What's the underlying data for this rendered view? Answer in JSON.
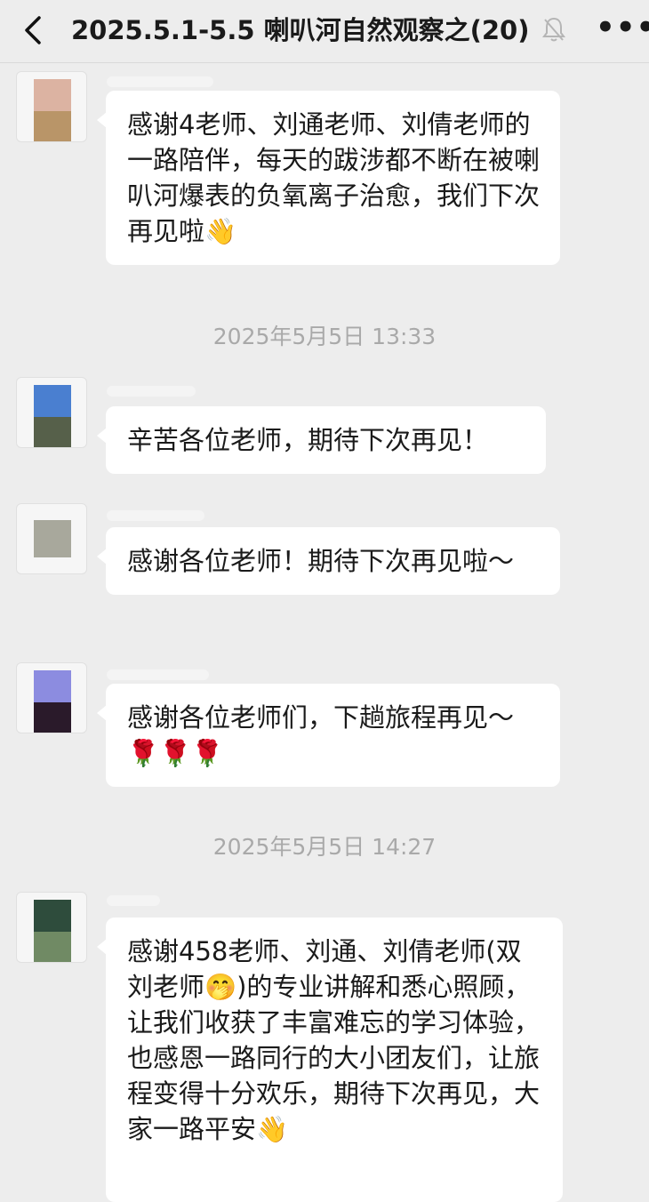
{
  "header": {
    "back_glyph": "‹",
    "title": "2025.5.1-5.5 喇叭河自然观察之(20)",
    "more_glyph": "•••",
    "icons": {
      "back": "back-arrow-icon",
      "mute": "bell-muted-icon",
      "more": "more-dots-icon"
    }
  },
  "messages": [
    {
      "text": "感谢4老师、刘通老师、刘倩老师的一路陪伴，每天的跋涉都不断在被喇叭河爆表的负氧离子治愈，我们下次再见啦👋",
      "avatar_colors": [
        "#dcb3a2",
        "#b99568"
      ]
    },
    {
      "text": "辛苦各位老师，期待下次再见！",
      "avatar_colors": [
        "#4a7fd0",
        "#56604a"
      ]
    },
    {
      "text": "感谢各位老师！期待下次再见啦～",
      "avatar_colors": [
        "#a8a89c",
        "#a8a89c"
      ]
    },
    {
      "text": "感谢各位老师们，下趟旅程再见～🌹🌹🌹",
      "avatar_colors": [
        "#8c8ce0",
        "#2a1a2a"
      ]
    },
    {
      "text": "感谢458老师、刘通、刘倩老师(双刘老师🤭)的专业讲解和悉心照顾，让我们收获了丰富难忘的学习体验，也感恩一路同行的大小团友们，让旅程变得十分欢乐，期待下次再见，大家一路平安👋",
      "avatar_colors": [
        "#2e4c3c",
        "#708a64"
      ]
    }
  ],
  "timestamps": [
    "2025年5月5日 13:33",
    "2025年5月5日 14:27"
  ]
}
